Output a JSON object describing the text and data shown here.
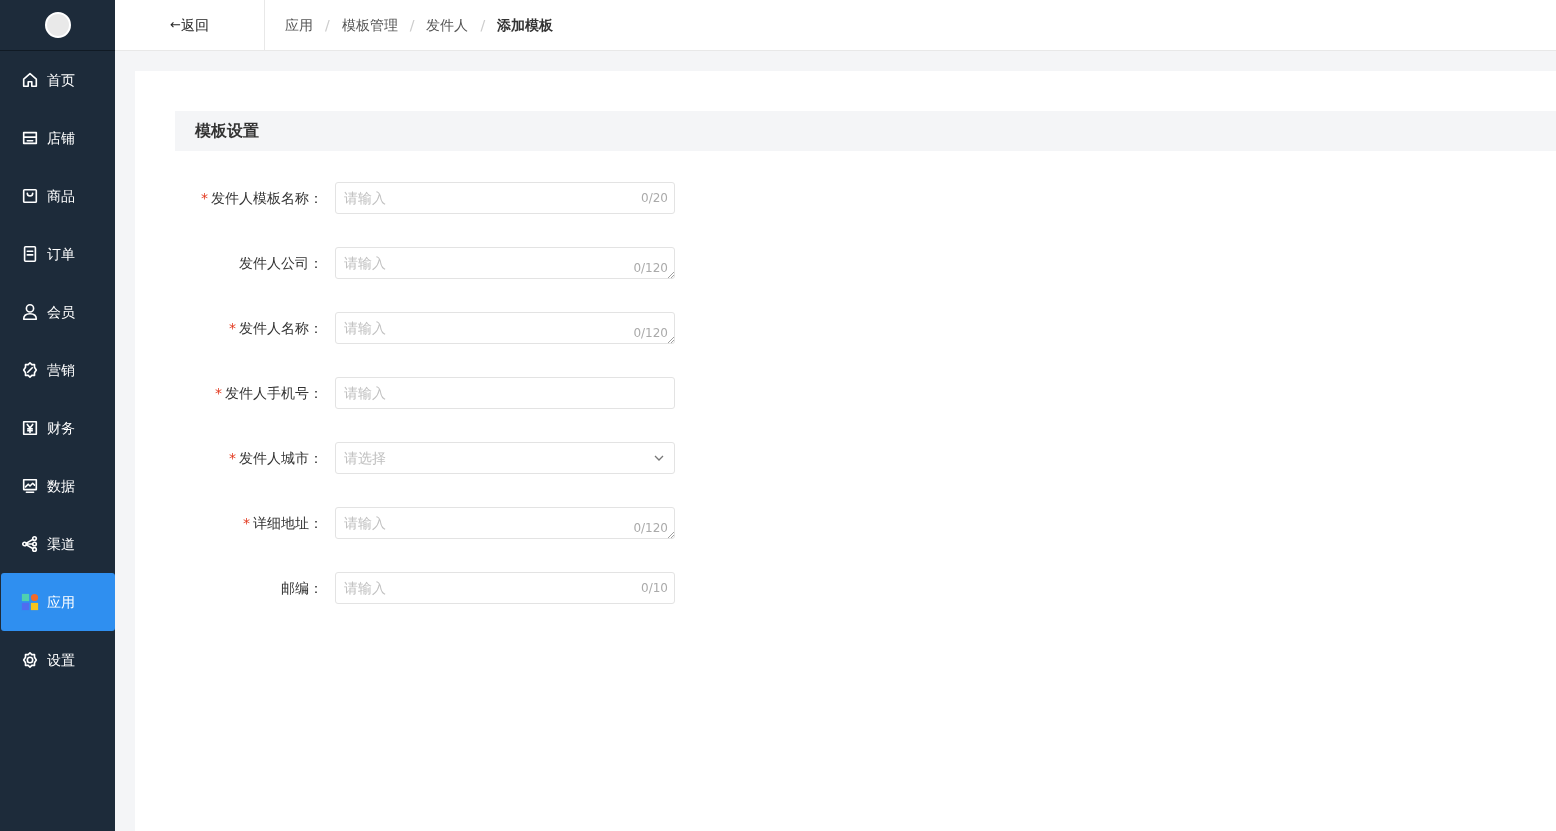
{
  "sidebar": {
    "items": [
      {
        "label": "首页",
        "selected": false
      },
      {
        "label": "店铺",
        "selected": false
      },
      {
        "label": "商品",
        "selected": false
      },
      {
        "label": "订单",
        "selected": false
      },
      {
        "label": "会员",
        "selected": false
      },
      {
        "label": "营销",
        "selected": false
      },
      {
        "label": "财务",
        "selected": false
      },
      {
        "label": "数据",
        "selected": false
      },
      {
        "label": "渠道",
        "selected": false
      },
      {
        "label": "应用",
        "selected": true
      },
      {
        "label": "设置",
        "selected": false
      }
    ]
  },
  "header": {
    "back": {
      "arrow": "←",
      "label": "返回"
    },
    "breadcrumb": [
      {
        "label": "应用",
        "selected": false
      },
      {
        "separator": "/",
        "label": "模板管理",
        "selected": false
      },
      {
        "separator": "/",
        "label": "发件人",
        "selected": false
      },
      {
        "separator": "/",
        "label": "添加模板",
        "selected": true
      }
    ]
  },
  "section_title": "模板设置",
  "form": {
    "fields": [
      {
        "kind": "input",
        "required_mark": "*",
        "label": "发件人模板名称：",
        "placeholder": "请输入",
        "counter": "0/20"
      },
      {
        "kind": "textarea",
        "label": "发件人公司：",
        "placeholder": "请输入",
        "counter": "0/120"
      },
      {
        "kind": "textarea",
        "required_mark": "*",
        "label": "发件人名称：",
        "placeholder": "请输入",
        "counter": "0/120"
      },
      {
        "kind": "input",
        "required_mark": "*",
        "label": "发件人手机号：",
        "placeholder": "请输入"
      },
      {
        "kind": "select",
        "required_mark": "*",
        "label": "发件人城市：",
        "placeholder": "请选择"
      },
      {
        "kind": "textarea",
        "required_mark": "*",
        "label": "详细地址：",
        "placeholder": "请输入",
        "counter": "0/120"
      },
      {
        "kind": "input",
        "label": "邮编：",
        "placeholder": "请输入",
        "counter": "0/10"
      }
    ]
  }
}
